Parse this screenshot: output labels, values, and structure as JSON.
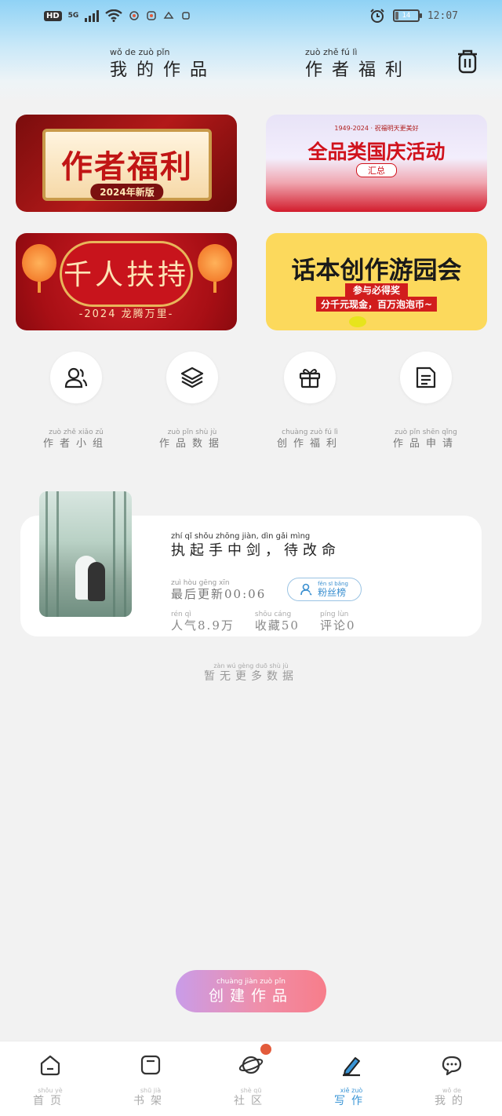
{
  "status_bar": {
    "network_badge": "HD",
    "network_type": "5G",
    "battery_level": "14",
    "battery_fraction": 0.14,
    "time": "12:07"
  },
  "header": {
    "tab_works": {
      "pinyin": "wǒ de zuò pǐn",
      "label": "我的作品"
    },
    "tab_benefits": {
      "pinyin": "zuò zhě fú lì",
      "label": "作者福利"
    }
  },
  "banners": {
    "author_benefits": {
      "title": "作者福利",
      "subtitle": "2024年新版"
    },
    "national_day": {
      "small": "1949-2024 · 祝福明天更美好",
      "title": "全品类国庆活动",
      "subtitle": "汇总"
    },
    "support": {
      "title": "千人扶持",
      "subtitle": "-2024 龙腾万里-"
    },
    "garden": {
      "title": "话本创作游园会",
      "line1": "参与必得奖",
      "line2": "分千元现金，百万泡泡币~"
    }
  },
  "quick_actions": [
    {
      "pinyin": "zuò zhě xiǎo zǔ",
      "label": "作者小组",
      "icon": "users-icon"
    },
    {
      "pinyin": "zuò pǐn shù jù",
      "label": "作品数据",
      "icon": "layers-icon"
    },
    {
      "pinyin": "chuàng zuò fú lì",
      "label": "创作福利",
      "icon": "gift-icon"
    },
    {
      "pinyin": "zuò pǐn shēn qǐng",
      "label": "作品申请",
      "icon": "document-icon"
    }
  ],
  "work": {
    "title_pinyin": "zhí qǐ shǒu zhōng jiàn, dìn gǎi mìng",
    "title": "执起手中剑，待改命",
    "update_pinyin": "zuì hòu gēng xīn",
    "update_label": "最后更新",
    "update_time": "00:06",
    "fans_pinyin": "fěn sī bǎng",
    "fans_label": "粉丝榜",
    "popularity_pinyin": "rén qì",
    "popularity_label": "人气",
    "popularity_value": "8.9万",
    "favorites_pinyin": "shōu cáng",
    "favorites_label": "收藏",
    "favorites_value": "50",
    "comments_pinyin": "píng lùn",
    "comments_label": "评论",
    "comments_value": "0"
  },
  "no_more": {
    "pinyin": "zàn wú gèng duō shù jù",
    "label": "暂无更多数据"
  },
  "create_button": {
    "pinyin": "chuàng jiàn zuò pǐn",
    "label": "创建作品"
  },
  "nav": [
    {
      "pinyin": "shǒu yè",
      "label": "首页",
      "icon": "home-icon"
    },
    {
      "pinyin": "shū jià",
      "label": "书架",
      "icon": "bookshelf-icon"
    },
    {
      "pinyin": "shè qū",
      "label": "社区",
      "icon": "planet-icon"
    },
    {
      "pinyin": "xiě zuò",
      "label": "写作",
      "icon": "pen-icon"
    },
    {
      "pinyin": "wǒ de",
      "label": "我的",
      "icon": "chat-icon"
    }
  ],
  "colors": {
    "accent": "#3a95d6",
    "badge": "#e35b3b",
    "create_start": "#c99ce9",
    "create_end": "#f77d8a"
  }
}
